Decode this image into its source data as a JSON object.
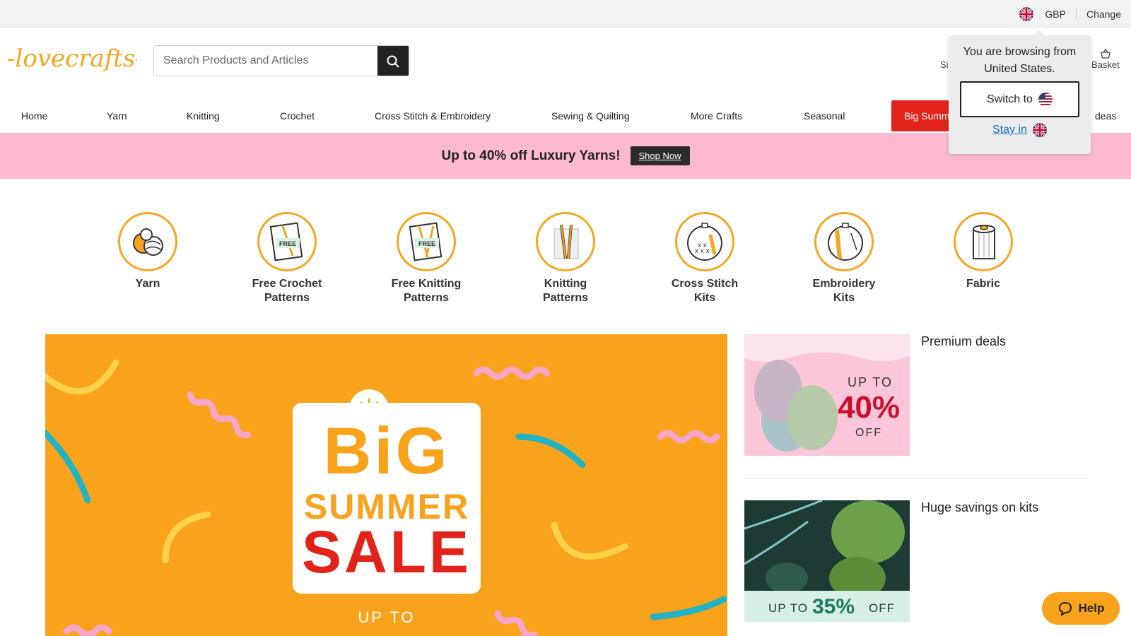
{
  "topbar": {
    "currency": "GBP",
    "change_label": "Change",
    "flag_icon": "uk-flag-icon"
  },
  "header": {
    "logo_text": "-lovecrafts-",
    "search_placeholder": "Search Products and Articles",
    "signin_label": "Si",
    "basket_label": "Basket"
  },
  "nav": {
    "items": [
      "Home",
      "Yarn",
      "Knitting",
      "Crochet",
      "Cross Stitch & Embroidery",
      "Sewing & Quilting",
      "More Crafts",
      "Seasonal"
    ],
    "sale_label": "Big Summ",
    "ideas_label": "deas"
  },
  "promo": {
    "text": "Up to 40% off Luxury Yarns!",
    "cta": "Shop Now"
  },
  "categories": [
    {
      "label_1": "Yarn",
      "label_2": ""
    },
    {
      "label_1": "Free Crochet",
      "label_2": "Patterns",
      "badge": "FREE"
    },
    {
      "label_1": "Free Knitting",
      "label_2": "Patterns",
      "badge": "FREE"
    },
    {
      "label_1": "Knitting",
      "label_2": "Patterns"
    },
    {
      "label_1": "Cross Stitch",
      "label_2": "Kits"
    },
    {
      "label_1": "Embroidery",
      "label_2": "Kits"
    },
    {
      "label_1": "Fabric",
      "label_2": ""
    }
  ],
  "hero": {
    "line1": "BiG",
    "line2": "SUMMER",
    "line3": "SALE",
    "line4": "UP TO"
  },
  "deals": [
    {
      "title": "Premium deals",
      "img_line1": "UP TO",
      "img_line2": "40%",
      "img_line3": "OFF"
    },
    {
      "title": "Huge savings on kits",
      "img_prefix": "UP TO",
      "img_value": "35%",
      "img_suffix": "OFF"
    }
  ],
  "popup": {
    "message": "You are browsing from United States.",
    "switch_label": "Switch to",
    "stay_label": "Stay in"
  },
  "help": {
    "label": "Help"
  },
  "colors": {
    "brand_orange": "#f8a31b",
    "sale_red": "#e2231a",
    "promo_pink": "#fdb9d0"
  }
}
